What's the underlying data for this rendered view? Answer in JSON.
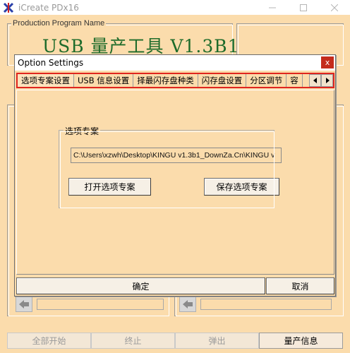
{
  "app": {
    "title": "iCreate PDx16",
    "group_label": "Production Program Name",
    "banner": "USB 量产工具 V1.3B1"
  },
  "bottom_buttons": [
    {
      "label": "全部开始",
      "enabled": false
    },
    {
      "label": "终止",
      "enabled": false
    },
    {
      "label": "弹出",
      "enabled": false
    },
    {
      "label": "量产信息",
      "enabled": true
    }
  ],
  "dialog": {
    "title": "Option Settings",
    "close": "x",
    "tabs": [
      "选项专案设置",
      "USB 信息设置",
      "择最闪存盘种类",
      "闪存盘设置",
      "分区调节",
      "容"
    ],
    "scheme_group": {
      "legend": "选项专案",
      "path": "C:\\Users\\xzwh\\Desktop\\KINGU v1.3b1_DownZa.Cn\\KINGU v",
      "open_button": "打开选项专案",
      "save_button": "保存选项专案"
    },
    "ok_button": "确定",
    "cancel_button": "取消"
  },
  "colors": {
    "background": "#fbdcac",
    "banner_text": "#1e6b2a",
    "close_red": "#c42b1c",
    "highlight_red": "#e0261e"
  }
}
